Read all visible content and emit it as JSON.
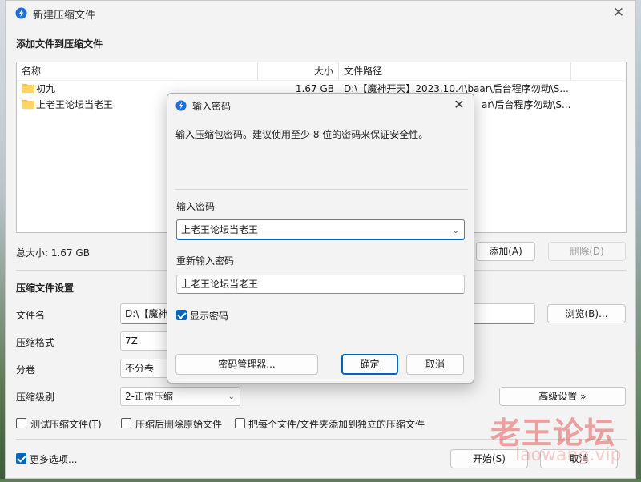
{
  "window": {
    "title": "新建压缩文件",
    "close_glyph": "✕"
  },
  "add_section": {
    "title": "添加文件到压缩文件",
    "columns": [
      "名称",
      "大小",
      "文件路径"
    ],
    "rows": [
      {
        "name": "初九",
        "size": "1.67 GB",
        "path": "D:\\【魔神开天】2023.10.4\\baar\\后台程序勿动\\S..."
      },
      {
        "name": "上老王论坛当老王",
        "size": "",
        "path": "ar\\后台程序勿动\\S..."
      }
    ],
    "total_size": "总大小: 1.67 GB",
    "add_button": "添加(A)",
    "delete_button": "删除(D)"
  },
  "settings": {
    "title": "压缩文件设置",
    "filename_label": "文件名",
    "filename_value": "D:\\【魔神",
    "browse_button": "浏览(B)...",
    "format_label": "压缩格式",
    "format_value": "7Z",
    "volume_label": "分卷",
    "volume_value": "不分卷",
    "level_label": "压缩级别",
    "level_value": "2-正常压缩",
    "advanced_button": "高级设置 »",
    "test_checkbox": "测试压缩文件(T)",
    "delete_after_checkbox": "压缩后删除原始文件",
    "each_separate_checkbox": "把每个文件/文件夹添加到独立的压缩文件",
    "more_options_checkbox": "更多选项...",
    "start_button": "开始(S)",
    "cancel_button": "取消"
  },
  "password_dialog": {
    "title": "输入密码",
    "close_glyph": "✕",
    "description": "输入压缩包密码。建议使用至少 8 位的密码来保证安全性。",
    "password_label": "输入密码",
    "password_value": "上老王论坛当老王",
    "reenter_label": "重新输入密码",
    "reenter_value": "上老王论坛当老王",
    "show_password": "显示密码",
    "manager_button": "密码管理器...",
    "ok_button": "确定",
    "cancel_button": "取消"
  },
  "watermark": {
    "main": "老王论坛",
    "sub": "laowang.vip"
  },
  "colors": {
    "accent": "#0067c0",
    "folder": "#f5c542",
    "window_bg": "#f3f3f3"
  },
  "icons": {
    "app": "bandizip-app-icon",
    "folder": "folder-icon",
    "chevron": "chevron-down-icon"
  }
}
